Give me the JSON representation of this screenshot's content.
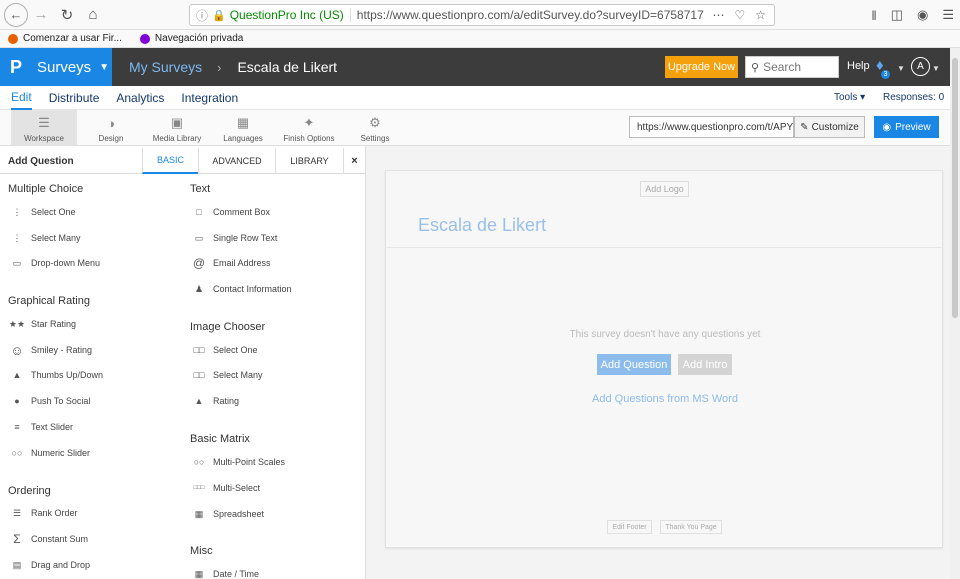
{
  "browser": {
    "org_name": "QuestionPro Inc (US)",
    "url": "https://www.questionpro.com/a/editSurvey.do?surveyID=6758717",
    "bookmarks": [
      {
        "label": "Comenzar a usar Fir...",
        "color": "#e66000"
      },
      {
        "label": "Navegación privada",
        "color": "#8000d7"
      }
    ]
  },
  "header": {
    "logo_letter": "P",
    "product": "Surveys",
    "breadcrumb_root": "My Surveys",
    "breadcrumb_current": "Escala de Likert",
    "upgrade_label": "Upgrade Now",
    "search_placeholder": "Search",
    "help_label": "Help",
    "notification_count": "3",
    "avatar_letter": "A"
  },
  "menu": {
    "items": [
      "Edit",
      "Distribute",
      "Analytics",
      "Integration"
    ],
    "tools": "Tools",
    "responses": "Responses: 0"
  },
  "toolbar": {
    "tools": [
      {
        "label": "Workspace",
        "icon": "workspace-icon"
      },
      {
        "label": "Design",
        "icon": "palette-icon"
      },
      {
        "label": "Media Library",
        "icon": "image-icon"
      },
      {
        "label": "Languages",
        "icon": "language-icon"
      },
      {
        "label": "Finish Options",
        "icon": "wand-icon"
      },
      {
        "label": "Settings",
        "icon": "gear-icon"
      }
    ],
    "survey_url": "https://www.questionpro.com/t/APY",
    "customize_label": "Customize",
    "preview_label": "Preview"
  },
  "panel": {
    "title": "Add Question",
    "tabs": [
      "BASIC",
      "ADVANCED",
      "LIBRARY"
    ],
    "close": "×",
    "left_sections": [
      {
        "title": "Multiple Choice",
        "items": [
          {
            "label": "Select One",
            "icon": "radio-icon"
          },
          {
            "label": "Select Many",
            "icon": "checkbox-icon"
          },
          {
            "label": "Drop-down Menu",
            "icon": "dropdown-icon"
          }
        ]
      },
      {
        "title": "Graphical Rating",
        "items": [
          {
            "label": "Star Rating",
            "icon": "star-icon"
          },
          {
            "label": "Smiley - Rating",
            "icon": "smiley-icon"
          },
          {
            "label": "Thumbs Up/Down",
            "icon": "thumbs-up-icon"
          },
          {
            "label": "Push To Social",
            "icon": "share-icon"
          },
          {
            "label": "Text Slider",
            "icon": "slider-icon"
          },
          {
            "label": "Numeric Slider",
            "icon": "numeric-slider-icon"
          }
        ]
      },
      {
        "title": "Ordering",
        "items": [
          {
            "label": "Rank Order",
            "icon": "rank-order-icon"
          },
          {
            "label": "Constant Sum",
            "icon": "sigma-icon"
          },
          {
            "label": "Drag and Drop",
            "icon": "drag-drop-icon"
          }
        ]
      }
    ],
    "right_sections": [
      {
        "title": "Text",
        "items": [
          {
            "label": "Comment Box",
            "icon": "comment-box-icon"
          },
          {
            "label": "Single Row Text",
            "icon": "single-row-icon"
          },
          {
            "label": "Email Address",
            "icon": "at-icon"
          },
          {
            "label": "Contact Information",
            "icon": "contact-icon"
          }
        ]
      },
      {
        "title": "Image Chooser",
        "items": [
          {
            "label": "Select One",
            "icon": "image-select-icon"
          },
          {
            "label": "Select Many",
            "icon": "image-multi-icon"
          },
          {
            "label": "Rating",
            "icon": "image-rating-icon"
          }
        ]
      },
      {
        "title": "Basic Matrix",
        "items": [
          {
            "label": "Multi-Point Scales",
            "icon": "multi-point-icon"
          },
          {
            "label": "Multi-Select",
            "icon": "multi-select-icon"
          },
          {
            "label": "Spreadsheet",
            "icon": "spreadsheet-icon"
          }
        ]
      },
      {
        "title": "Misc",
        "items": [
          {
            "label": "Date / Time",
            "icon": "calendar-icon"
          }
        ]
      }
    ]
  },
  "canvas": {
    "add_logo": "Add Logo",
    "survey_title": "Escala de Likert",
    "empty_message": "This survey doesn't have any questions yet",
    "add_question": "Add Question",
    "add_intro": "Add Intro",
    "ms_word": "Add Questions from MS Word",
    "edit_footer": "Edit Footer",
    "thank_you": "Thank You Page"
  }
}
